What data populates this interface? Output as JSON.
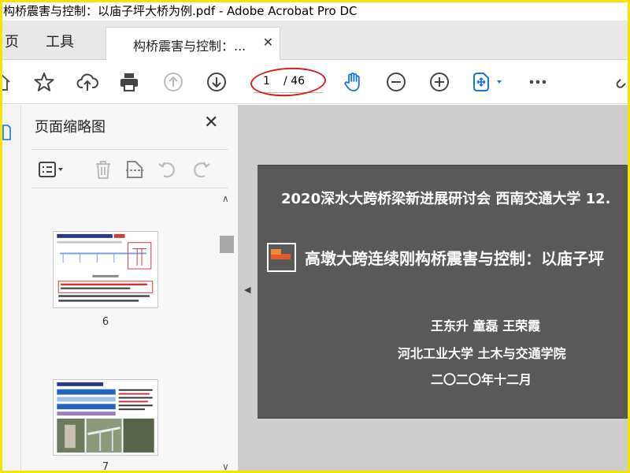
{
  "window": {
    "title": "构桥震害与控制：以庙子坪大桥为例.pdf - Adobe Acrobat Pro DC"
  },
  "tabs": {
    "home_label": "页",
    "tools_label": "工具",
    "document_tab_label": "构桥震害与控制：...",
    "close_glyph": "✕"
  },
  "toolbar": {
    "icons": [
      "home-icon",
      "bookmark-star-icon",
      "upload-cloud-icon",
      "print-icon",
      "previous-page-icon",
      "next-page-icon",
      "hand-tool-icon",
      "zoom-out-icon",
      "zoom-in-icon",
      "fit-page-icon",
      "more-icon",
      "link-icon"
    ],
    "current_page": "1",
    "total_pages": "/ 46",
    "highlight_color": "#d21f1f",
    "accent_color": "#1473e6"
  },
  "thumbnails_panel": {
    "title": "页面缩略图",
    "close_glyph": "✕",
    "tool_icons": [
      "thumbnail-options-icon",
      "delete-icon",
      "crop-icon",
      "rotate-left-icon",
      "rotate-right-icon"
    ],
    "items": [
      {
        "page_number": "6"
      },
      {
        "page_number": "7"
      }
    ]
  },
  "slide": {
    "header": "2020深水大跨桥梁新进展研讨会 西南交通大学   12.",
    "title": "高墩大跨连续刚构桥震害与控制：以庙子坪",
    "authors": "王东升  童磊  王荣霞",
    "institution": "河北工业大学 土木与交通学院",
    "date": "二〇二〇年十二月",
    "background_color": "#595959",
    "icon_colors": [
      "#f08a3a",
      "#e35a2a"
    ]
  }
}
